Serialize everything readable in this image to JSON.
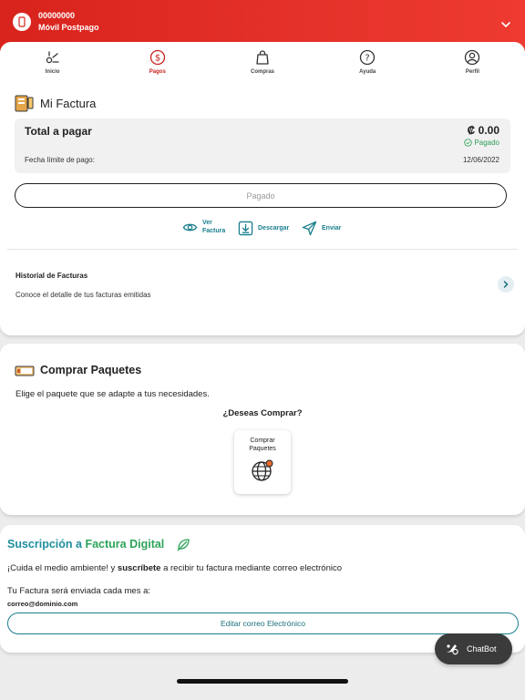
{
  "header": {
    "line_number": "00000000",
    "plan": "Móvil Postpago",
    "icons": {
      "line": "phone-icon",
      "toggle": "chevron-down-icon"
    }
  },
  "nav": {
    "items": [
      {
        "label": "Inicio",
        "icon": "home-icon"
      },
      {
        "label": "Pagos",
        "icon": "dollar-circle-icon",
        "active": true
      },
      {
        "label": "Compras",
        "icon": "shopping-bag-icon"
      },
      {
        "label": "Ayuda",
        "icon": "question-icon"
      },
      {
        "label": "Perfil",
        "icon": "user-icon"
      }
    ]
  },
  "invoice": {
    "title": "Mi Factura",
    "total_label": "Total a pagar",
    "total_amount": "₡ 0.00",
    "status": "Pagado",
    "due_label": "Fecha límite de pago:",
    "due_date": "12/06/2022",
    "paid_button": "Pagado",
    "actions": {
      "view_line1": "Ver",
      "view_line2": "Factura",
      "download": "Descargar",
      "send": "Enviar"
    },
    "history": {
      "title": "Historial de Facturas",
      "description": "Conoce el detalle de tus facturas emitidas"
    }
  },
  "packages": {
    "title": "Comprar Paquetes",
    "description": "Elige el paquete que se adapte a tus necesidades.",
    "question": "¿Deseas Comprar?",
    "card_label": "Comprar Paquetes"
  },
  "subscription": {
    "title_part1": "Suscripción a ",
    "title_part2": "Factura Digital",
    "desc_part1": "¡Cuida el medio ambiente! y ",
    "desc_bold": "suscríbete",
    "desc_part2": " a recibir tu factura mediante correo electrónico",
    "sent_text": "Tu Factura será enviada cada mes a:",
    "email": "correo@dominio.com",
    "edit_button": "Editar correo Electrónico"
  },
  "chatbot": {
    "label": "ChatBot"
  },
  "colors": {
    "brand_red": "#d8231c",
    "teal": "#1a7f8e",
    "green": "#2ea35a"
  }
}
